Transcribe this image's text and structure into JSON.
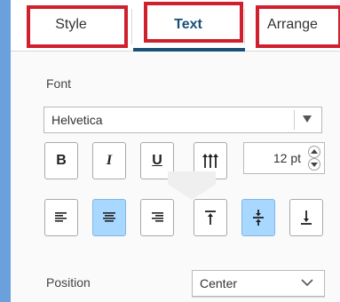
{
  "tabs": [
    {
      "label": "Style",
      "highlighted": true
    },
    {
      "label": "Text",
      "selected": true,
      "highlighted": true
    },
    {
      "label": "Arrange",
      "highlighted": true
    }
  ],
  "font": {
    "label": "Font",
    "value": "Helvetica"
  },
  "format_buttons": [
    {
      "name": "bold",
      "glyph": "B"
    },
    {
      "name": "italic",
      "glyph": "I"
    },
    {
      "name": "underline",
      "glyph": "U"
    },
    {
      "name": "vertical-text",
      "icon": "vertical-text-icon"
    }
  ],
  "font_size": {
    "value": "12 pt"
  },
  "align_buttons": [
    {
      "name": "align-left",
      "icon": "align-left-icon",
      "active": false
    },
    {
      "name": "align-center",
      "icon": "align-center-icon",
      "active": true
    },
    {
      "name": "align-right",
      "icon": "align-right-icon",
      "active": false
    },
    {
      "name": "align-top",
      "icon": "align-top-icon",
      "active": false
    },
    {
      "name": "align-middle",
      "icon": "align-middle-icon",
      "active": true
    },
    {
      "name": "align-bottom",
      "icon": "align-bottom-icon",
      "active": false
    }
  ],
  "position": {
    "label": "Position",
    "value": "Center"
  },
  "colors": {
    "accent": "#1a4f78",
    "highlight_box": "#d0202e",
    "active_button": "#a8d8ff",
    "background": "#6aa0dc"
  }
}
